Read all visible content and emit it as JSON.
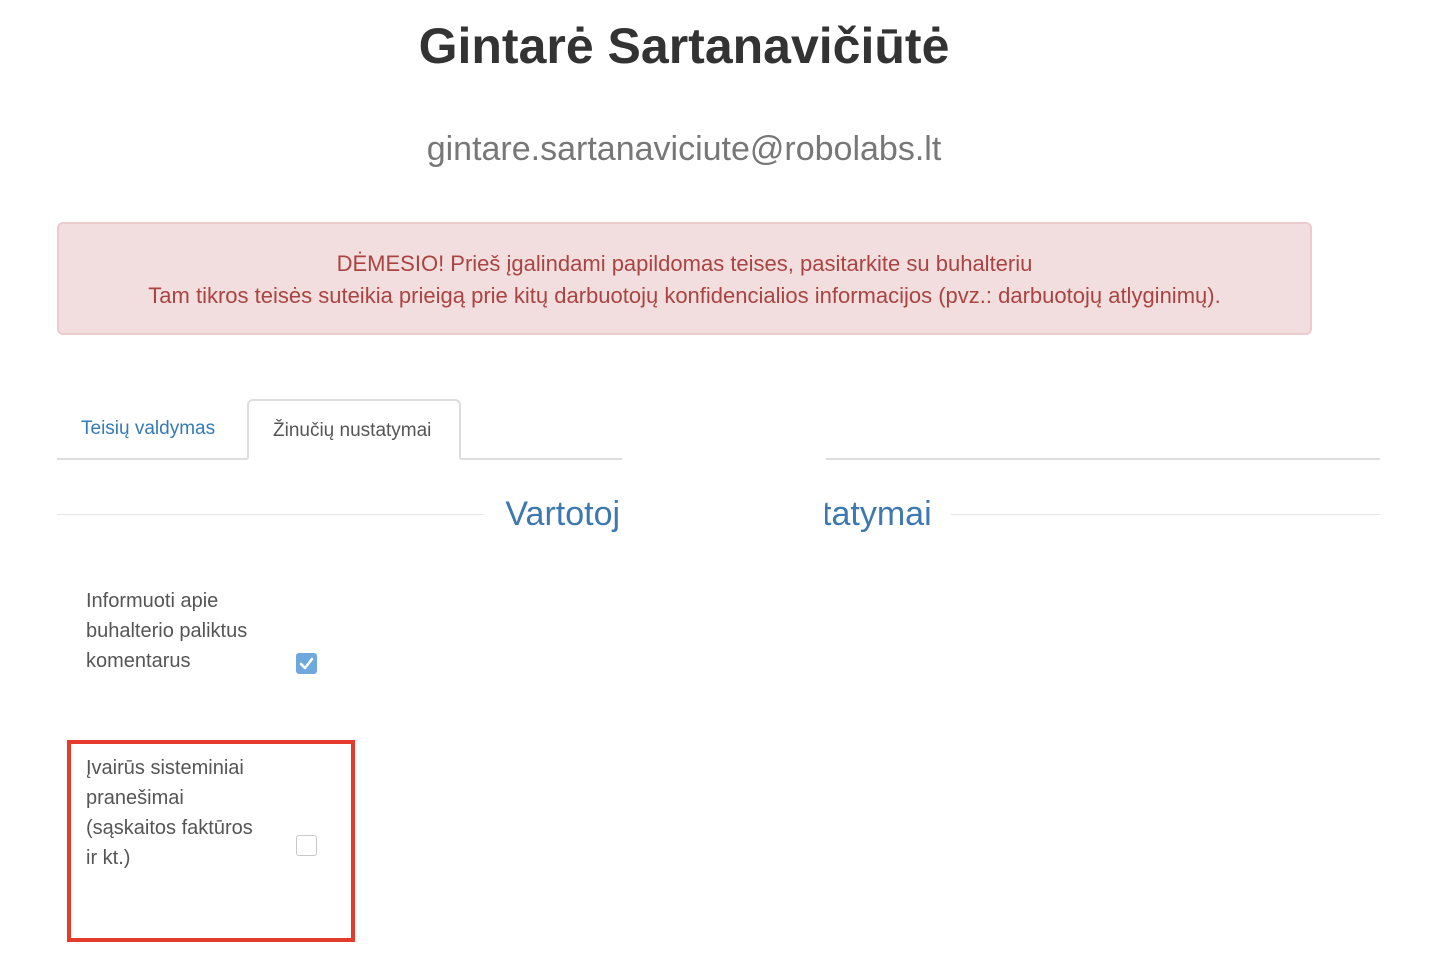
{
  "user": {
    "name": "Gintarė Sartanavičiūtė",
    "email": "gintare.sartanaviciute@robolabs.lt"
  },
  "alert": {
    "line1": "DĖMESIO! Prieš įgalindami papildomas teises, pasitarkite su buhalteriu",
    "line2": "Tam tikros teisės suteikia prieigą prie kitų darbuotojų konfidencialios informacijos (pvz.: darbuotojų atlyginimų).",
    "color": "#a94442",
    "background": "#f2dede"
  },
  "tabs": [
    {
      "label": "Teisių valdymas",
      "active": false
    },
    {
      "label": "Žinučių nustatymai",
      "active": true
    }
  ],
  "section": {
    "title_left": "Vartotoj",
    "title_right": "tatymai"
  },
  "settings": [
    {
      "label": "Informuoti apie buhalterio paliktus komentarus",
      "checked": true
    },
    {
      "label": "Įvairūs sisteminiai pranešimai (sąskaitos faktūros ir kt.)",
      "checked": false
    }
  ],
  "colors": {
    "link": "#337ab7",
    "heading": "#3d78b1",
    "highlight": "#e53b2c",
    "checkbox_checked": "#6fa8dc"
  }
}
